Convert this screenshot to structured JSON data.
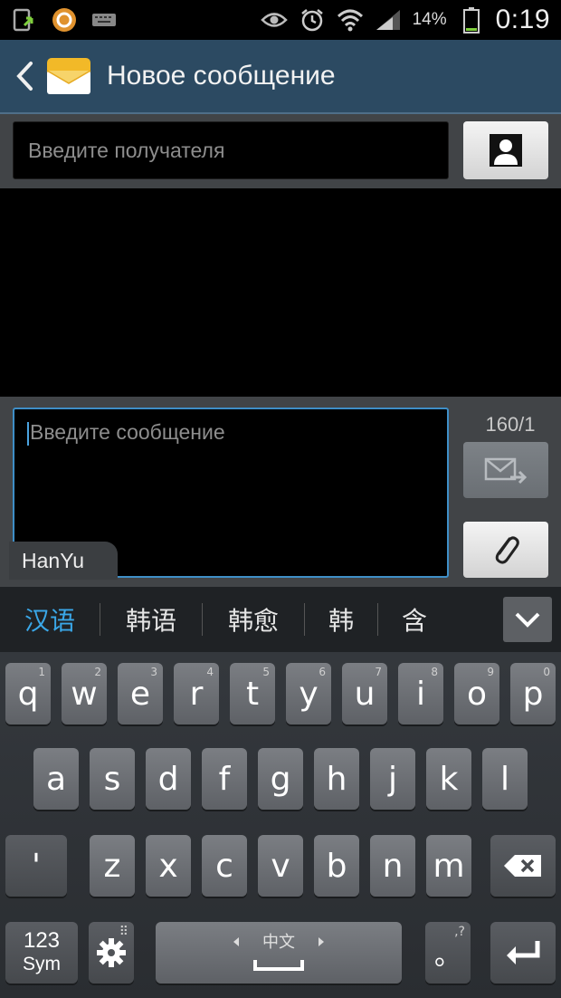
{
  "status_bar": {
    "battery_percent": "14%",
    "time": "0:19",
    "icons": [
      "app-update-icon",
      "orange-app-icon",
      "keyboard-icon",
      "eye-icon",
      "alarm-icon",
      "wifi-icon",
      "signal-icon",
      "battery-icon"
    ]
  },
  "header": {
    "title": "Новое сообщение"
  },
  "recipient": {
    "placeholder": "Введите получателя"
  },
  "compose": {
    "placeholder": "Введите сообщение",
    "char_counter": "160/1",
    "ime_label": "HanYu"
  },
  "candidates": [
    "汉语",
    "韩语",
    "韩愈",
    "韩",
    "含"
  ],
  "keyboard": {
    "row1": [
      {
        "key": "q",
        "alt": "1"
      },
      {
        "key": "w",
        "alt": "2"
      },
      {
        "key": "e",
        "alt": "3"
      },
      {
        "key": "r",
        "alt": "4"
      },
      {
        "key": "t",
        "alt": "5"
      },
      {
        "key": "y",
        "alt": "6"
      },
      {
        "key": "u",
        "alt": "7"
      },
      {
        "key": "i",
        "alt": "8"
      },
      {
        "key": "o",
        "alt": "9"
      },
      {
        "key": "p",
        "alt": "0"
      }
    ],
    "row2": [
      "a",
      "s",
      "d",
      "f",
      "g",
      "h",
      "j",
      "k",
      "l"
    ],
    "row3": [
      "'",
      "z",
      "x",
      "c",
      "v",
      "b",
      "n",
      "m"
    ],
    "sym_label_top": "123",
    "sym_label_bottom": "Sym",
    "space_label": "中文",
    "punct_key": "。",
    "punct_alt": ",?",
    "colors": {
      "accent": "#3aa7e8",
      "header": "#2c4a62",
      "key": "#6c7075"
    }
  }
}
